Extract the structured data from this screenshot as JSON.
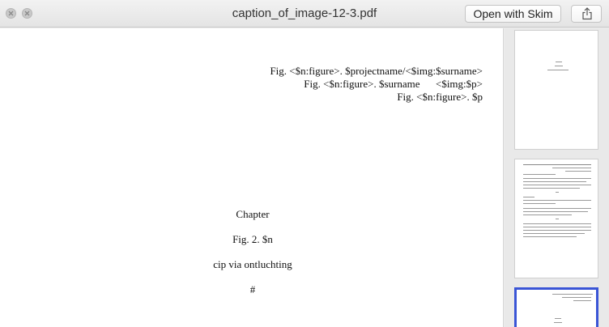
{
  "window": {
    "title": "caption_of_image-12-3.pdf",
    "open_button_label": "Open with Skim",
    "share_icon": "share-icon",
    "close_icon": "close-icon",
    "minimize_icon": "minimize-icon"
  },
  "document": {
    "caption_lines": [
      "Fig. <$n:figure>. $projectname/<$img:$surname>",
      "Fig. <$n:figure>. $surname      <$img:$p>",
      "Fig. <$n:figure>. $p"
    ],
    "chapter": "Chapter",
    "fig_line": "Fig. 2. $n",
    "cip_line": "cip via ontluchting",
    "hash": "#"
  },
  "thumbnails": [
    {
      "selected": false
    },
    {
      "selected": false
    },
    {
      "selected": true
    }
  ],
  "colors": {
    "selection": "#3a55d6"
  }
}
